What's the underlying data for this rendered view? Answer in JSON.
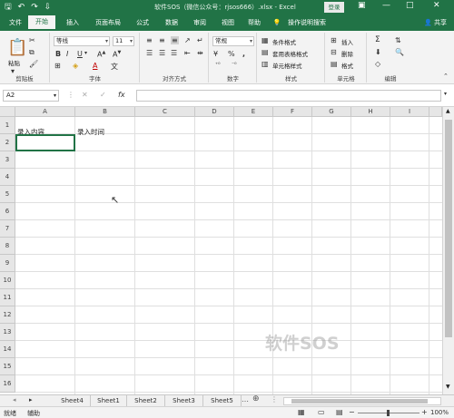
{
  "title_bar": {
    "title": "软件SOS（微信公众号：rjsos666）.xlsx  -  Excel",
    "login_label": "登录",
    "save_icon": "save-icon",
    "undo_icon": "undo-icon",
    "redo_icon": "redo-icon",
    "customize_icon": "customize-qat-icon"
  },
  "ribbon_tabs": [
    {
      "label": "文件"
    },
    {
      "label": "开始"
    },
    {
      "label": "插入"
    },
    {
      "label": "页面布局"
    },
    {
      "label": "公式"
    },
    {
      "label": "数据"
    },
    {
      "label": "审阅"
    },
    {
      "label": "视图"
    },
    {
      "label": "帮助"
    },
    {
      "label": "操作说明搜索"
    }
  ],
  "share_label": "共享",
  "ribbon": {
    "clipboard": {
      "paste_label": "粘贴",
      "group_label": "剪贴板"
    },
    "font": {
      "font_name": "等线",
      "font_size": "11",
      "bold": "B",
      "italic": "I",
      "underline": "U",
      "group_label": "字体"
    },
    "alignment": {
      "group_label": "对齐方式"
    },
    "number": {
      "format": "常规",
      "currency": "¥",
      "percent": "%",
      "comma": ",",
      "group_label": "数字"
    },
    "styles": {
      "conditional": "条件格式",
      "table": "套用表格格式",
      "cell_styles": "单元格样式",
      "group_label": "样式"
    },
    "cells": {
      "insert": "插入",
      "delete": "删除",
      "format": "格式",
      "group_label": "单元格"
    },
    "editing": {
      "sum": "Σ",
      "group_label": "编辑"
    }
  },
  "formula_bar": {
    "name_box": "A2",
    "fx": "fx",
    "value": ""
  },
  "columns": [
    "A",
    "B",
    "C",
    "D",
    "E",
    "F",
    "G",
    "H",
    "I"
  ],
  "rows": [
    "1",
    "2",
    "3",
    "4",
    "5",
    "6",
    "7",
    "8",
    "9",
    "10",
    "11",
    "12",
    "13",
    "14",
    "15",
    "16"
  ],
  "cells": {
    "A1": "录入内容",
    "B1": "录入时间"
  },
  "sheets": [
    "Sheet4",
    "Sheet1",
    "Sheet2",
    "Sheet3",
    "Sheet5"
  ],
  "status": {
    "ready": "就绪",
    "accessibility": "辅助",
    "zoom": "100%"
  },
  "watermark": "软件SOS",
  "colors": {
    "accent": "#217346",
    "ribbon_bg": "#f3f3f3",
    "header_bg": "#e6e6e6"
  }
}
